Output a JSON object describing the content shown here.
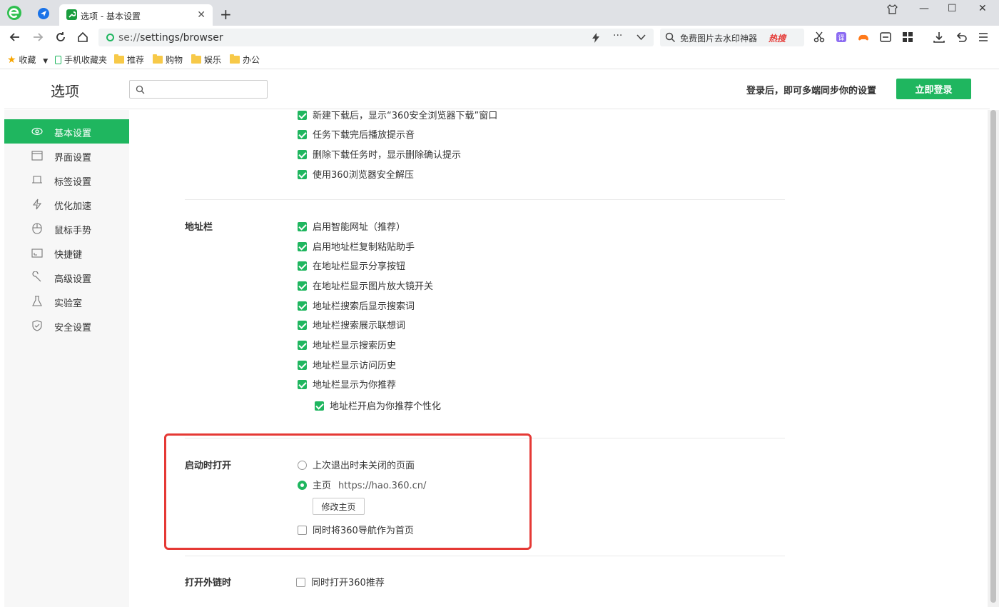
{
  "tab": {
    "title": "选项 - 基本设置",
    "close": "✕"
  },
  "window": {
    "newtab": "+",
    "minimize": "—",
    "maximize": "☐",
    "close": "✕"
  },
  "address": {
    "scheme": "se://",
    "path": "settings/browser"
  },
  "search_box": {
    "text": "免费图片去水印神器",
    "hot": "热搜"
  },
  "bookmarks": {
    "favorites": "收藏",
    "mobile": "手机收藏夹",
    "items": [
      "推荐",
      "购物",
      "娱乐",
      "办公"
    ]
  },
  "header": {
    "title": "选项",
    "sync_message": "登录后，即可多端同步你的设置",
    "login_button": "立即登录"
  },
  "sidebar": {
    "items": [
      {
        "label": "基本设置",
        "icon": "eye-icon",
        "active": true
      },
      {
        "label": "界面设置",
        "icon": "window-icon"
      },
      {
        "label": "标签设置",
        "icon": "tab-icon"
      },
      {
        "label": "优化加速",
        "icon": "lightning-icon"
      },
      {
        "label": "鼠标手势",
        "icon": "mouse-icon"
      },
      {
        "label": "快捷键",
        "icon": "keyboard-icon"
      },
      {
        "label": "高级设置",
        "icon": "wrench-icon"
      },
      {
        "label": "实验室",
        "icon": "flask-icon"
      },
      {
        "label": "安全设置",
        "icon": "shield-icon"
      }
    ]
  },
  "download_options": [
    {
      "label": "新建下载后，显示“360安全浏览器下载”窗口",
      "checked": true
    },
    {
      "label": "任务下载完后播放提示音",
      "checked": true
    },
    {
      "label": "删除下载任务时，显示删除确认提示",
      "checked": true
    },
    {
      "label": "使用360浏览器安全解压",
      "checked": true
    }
  ],
  "addressbar": {
    "section_title": "地址栏",
    "options": [
      {
        "label": "启用智能网址（推荐）",
        "checked": true
      },
      {
        "label": "启用地址栏复制粘贴助手",
        "checked": true
      },
      {
        "label": "在地址栏显示分享按钮",
        "checked": true
      },
      {
        "label": "在地址栏显示图片放大镜开关",
        "checked": true
      },
      {
        "label": "地址栏搜索后显示搜索词",
        "checked": true
      },
      {
        "label": "地址栏搜索展示联想词",
        "checked": true
      },
      {
        "label": "地址栏显示搜索历史",
        "checked": true
      },
      {
        "label": "地址栏显示访问历史",
        "checked": true
      },
      {
        "label": "地址栏显示为你推荐",
        "checked": true
      }
    ],
    "sub_option": {
      "label": "地址栏开启为你推荐个性化",
      "checked": true
    }
  },
  "startup": {
    "section_title": "启动时打开",
    "option_restore": "上次退出时未关闭的页面",
    "option_home_label": "主页",
    "home_url": "https://hao.360.cn/",
    "modify_button": "修改主页",
    "nav_as_home": "同时将360导航作为首页",
    "selected": "home"
  },
  "external_links": {
    "section_title": "打开外链时",
    "option": "同时打开360推荐"
  },
  "colors": {
    "accent": "#1fb65f",
    "highlight": "#e53935"
  }
}
